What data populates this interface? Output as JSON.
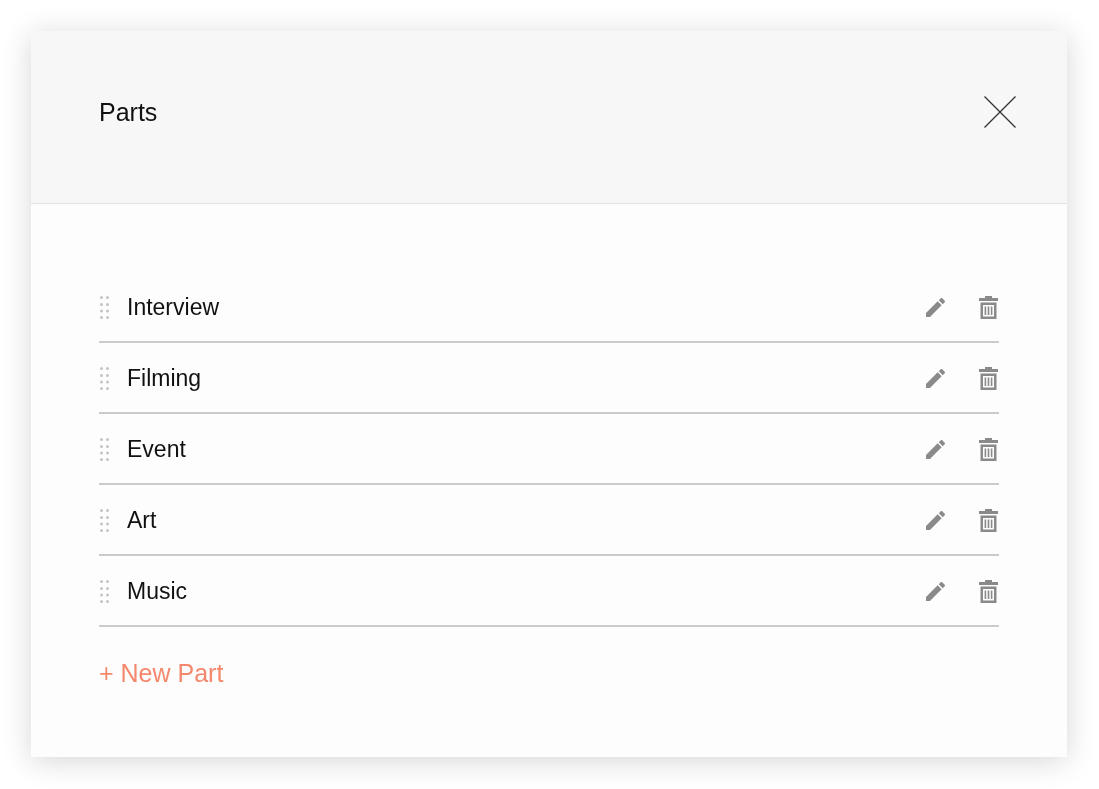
{
  "dialog": {
    "title": "Parts"
  },
  "parts": [
    {
      "name": "Interview"
    },
    {
      "name": "Filming"
    },
    {
      "name": "Event"
    },
    {
      "name": "Art"
    },
    {
      "name": "Music"
    }
  ],
  "new_part_link": "+ New Part"
}
